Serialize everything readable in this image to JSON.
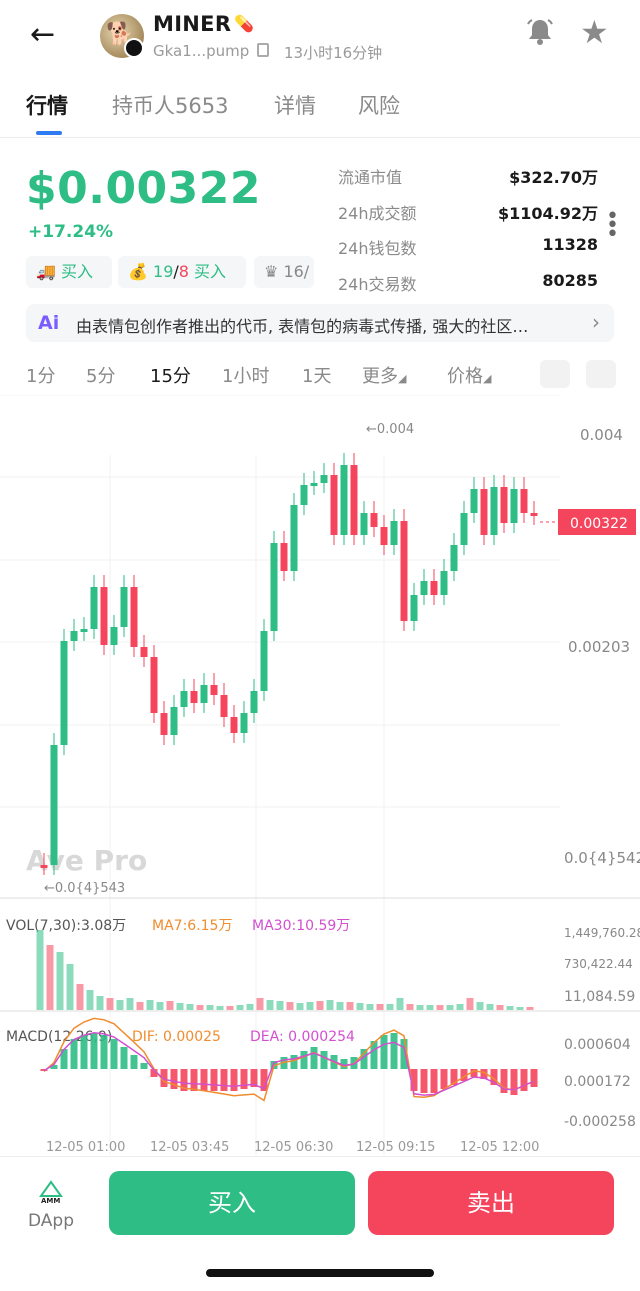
{
  "header": {
    "back_icon": "arrow-left-icon",
    "title": "MINER",
    "address": "Gka1...pump",
    "age": "13小时16分钟"
  },
  "tabs": [
    "行情",
    "持币人5653",
    "详情",
    "风险"
  ],
  "price": {
    "value": "$0.00322",
    "change": "+17.24%"
  },
  "stats": [
    {
      "label": "流通市值",
      "value": "$322.70万"
    },
    {
      "label": "24h成交额",
      "value": "$1104.92万"
    },
    {
      "label": "24h钱包数",
      "value": "11328"
    },
    {
      "label": "24h交易数",
      "value": "80285"
    }
  ],
  "chips": {
    "buy": "买入",
    "count_buy": "19",
    "count_slash": "/",
    "count_sell": "8",
    "count_label": "买入",
    "crown": "16/"
  },
  "ai_summary": "由表情包创作者推出的代币, 表情包的病毒式传播, 强大的社区…",
  "intervals": [
    "1分",
    "5分",
    "15分",
    "1小时",
    "1天",
    "更多",
    "价格"
  ],
  "chart_labels": {
    "max_marker": "←0.004",
    "min_marker": "←0.0{4}543",
    "price_axis": [
      "0.004",
      "0.00203",
      "0.0{4}542"
    ],
    "current_price": "0.00322",
    "watermark": "Ave Pro",
    "vol_title": "VOL(7,30):3.08万",
    "ma7": "MA7:6.15万",
    "ma30": "MA30:10.59万",
    "vol_axis": [
      "1,449,760.28",
      "730,422.44",
      "11,084.59"
    ],
    "macd_title": "MACD(12,26,9)",
    "dif": "DIF: 0.00025",
    "dea": "DEA: 0.000254",
    "macd_axis": [
      "0.000604",
      "0.000172",
      "-0.000258"
    ],
    "times": [
      "12-05 01:00",
      "12-05 03:45",
      "12-05 06:30",
      "12-05 09:15",
      "12-05 12:00"
    ]
  },
  "chart_data": {
    "type": "candlestick",
    "x_labels": [
      "12-05 01:00",
      "12-05 03:45",
      "12-05 06:30",
      "12-05 09:15",
      "12-05 12:00"
    ],
    "ylim": [
      5.42e-05,
      0.004
    ],
    "last_price": 0.00322,
    "high_marker": 0.004,
    "low_marker_label": "0.0{4}543",
    "volume_ylim": [
      0,
      1449760.28
    ],
    "macd": {
      "dif": 0.00025,
      "dea": 0.000254,
      "ylim": [
        -0.000258,
        0.000604
      ]
    }
  },
  "colors": {
    "up": "#2ebd85",
    "down": "#f4455d",
    "accent": "#2f7bf2"
  },
  "actions": {
    "dapp": "DApp",
    "buy": "买入",
    "sell": "卖出"
  }
}
